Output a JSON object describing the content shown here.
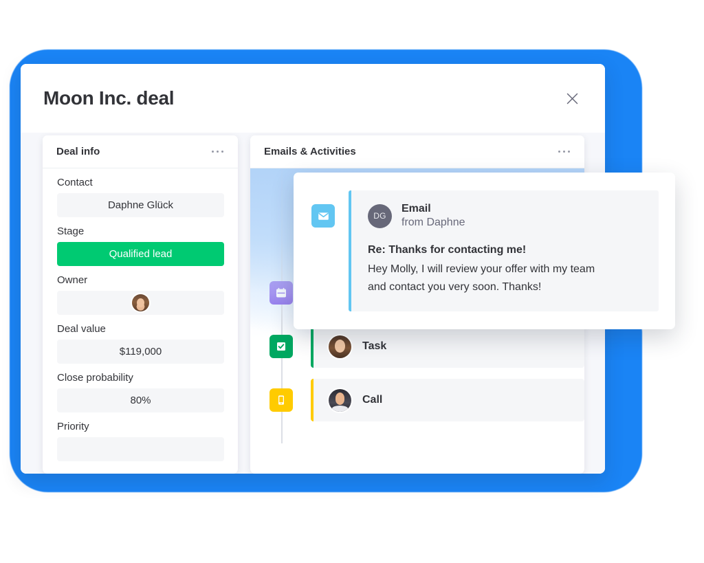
{
  "window": {
    "title": "Moon Inc. deal",
    "close_icon": "close-icon"
  },
  "deal_info": {
    "title": "Deal info",
    "menu_icon": "more-options-icon",
    "fields": [
      {
        "label": "Contact",
        "value": "Daphne Glück",
        "type": "text"
      },
      {
        "label": "Stage",
        "value": "Qualified lead",
        "type": "status",
        "color": "#00ca72"
      },
      {
        "label": "Owner",
        "value": "",
        "type": "avatar"
      },
      {
        "label": "Deal value",
        "value": "$119,000",
        "type": "text"
      },
      {
        "label": "Close probability",
        "value": "80%",
        "type": "text"
      },
      {
        "label": "Priority",
        "value": "",
        "type": "text"
      }
    ]
  },
  "activities": {
    "title": "Emails & Activities",
    "menu_icon": "more-options-icon",
    "rows": [
      {
        "name": "",
        "icon": "calendar-icon",
        "color": "#7d5ae8"
      },
      {
        "name": "Task",
        "icon": "checkbox-icon",
        "color": "#00a861"
      },
      {
        "name": "Call",
        "icon": "mobile-phone-icon",
        "color": "#ffcb00"
      }
    ]
  },
  "email_popup": {
    "icon": "envelope-icon",
    "accent_color": "#62c6f2",
    "avatar_initials": "DG",
    "kind": "Email",
    "from": "from Daphne",
    "subject": "Re: Thanks for contacting me!",
    "body_line_1": "Hey Molly, I will review your offer with my team",
    "body_line_2": "and contact you very soon. Thanks!"
  },
  "theme": {
    "backdrop_blue": "#1a84f5",
    "green": "#00ca72",
    "purple": "#7d5ae8",
    "yellow": "#ffcb00",
    "light_blue": "#62c6f2"
  }
}
